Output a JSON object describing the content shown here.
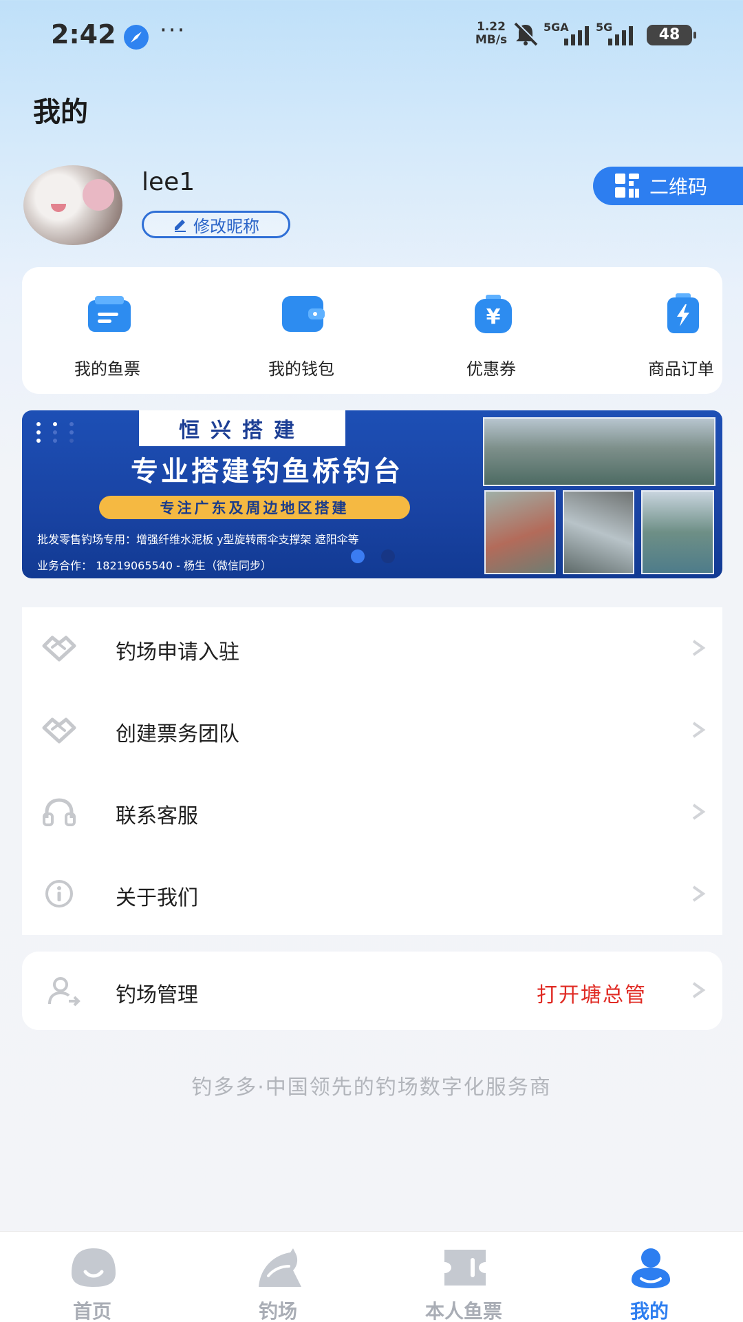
{
  "status_bar": {
    "time": "2:42",
    "more": "···",
    "speed_value": "1.22",
    "speed_unit": "MB/s",
    "net1": "5GA",
    "net2": "5G",
    "battery": "48"
  },
  "page_title": "我的",
  "profile": {
    "username": "lee1",
    "edit_nickname_label": "修改昵称",
    "qr_label": "二维码"
  },
  "shortcuts": [
    {
      "label": "我的鱼票",
      "icon": "ticket-icon"
    },
    {
      "label": "我的钱包",
      "icon": "wallet-icon"
    },
    {
      "label": "优惠券",
      "icon": "coupon-icon"
    },
    {
      "label": "商品订单",
      "icon": "order-icon"
    }
  ],
  "banner": {
    "company": "恒兴搭建",
    "headline": "专业搭建钓鱼桥钓台",
    "subline": "专注广东及周边地区搭建",
    "products": "批发零售钓场专用：增强纤维水泥板  y型旋转雨伞支撑架  遮阳伞等",
    "contact": "业务合作：  18219065540 - 杨生（微信同步）"
  },
  "menu": [
    {
      "label": "钓场申请入驻",
      "icon": "handshake-icon"
    },
    {
      "label": "创建票务团队",
      "icon": "handshake-icon"
    },
    {
      "label": "联系客服",
      "icon": "headset-icon"
    },
    {
      "label": "关于我们",
      "icon": "info-icon"
    }
  ],
  "management": {
    "label": "钓场管理",
    "action": "打开塘总管"
  },
  "footer_slogan": "钓多多·中国领先的钓场数字化服务商",
  "bottom_nav": [
    {
      "label": "首页",
      "active": false
    },
    {
      "label": "钓场",
      "active": false
    },
    {
      "label": "本人鱼票",
      "active": false
    },
    {
      "label": "我的",
      "active": true
    }
  ],
  "colors": {
    "accent": "#2d7ef0",
    "alert_red": "#e02b24",
    "inactive_gray": "#a9adb5"
  }
}
